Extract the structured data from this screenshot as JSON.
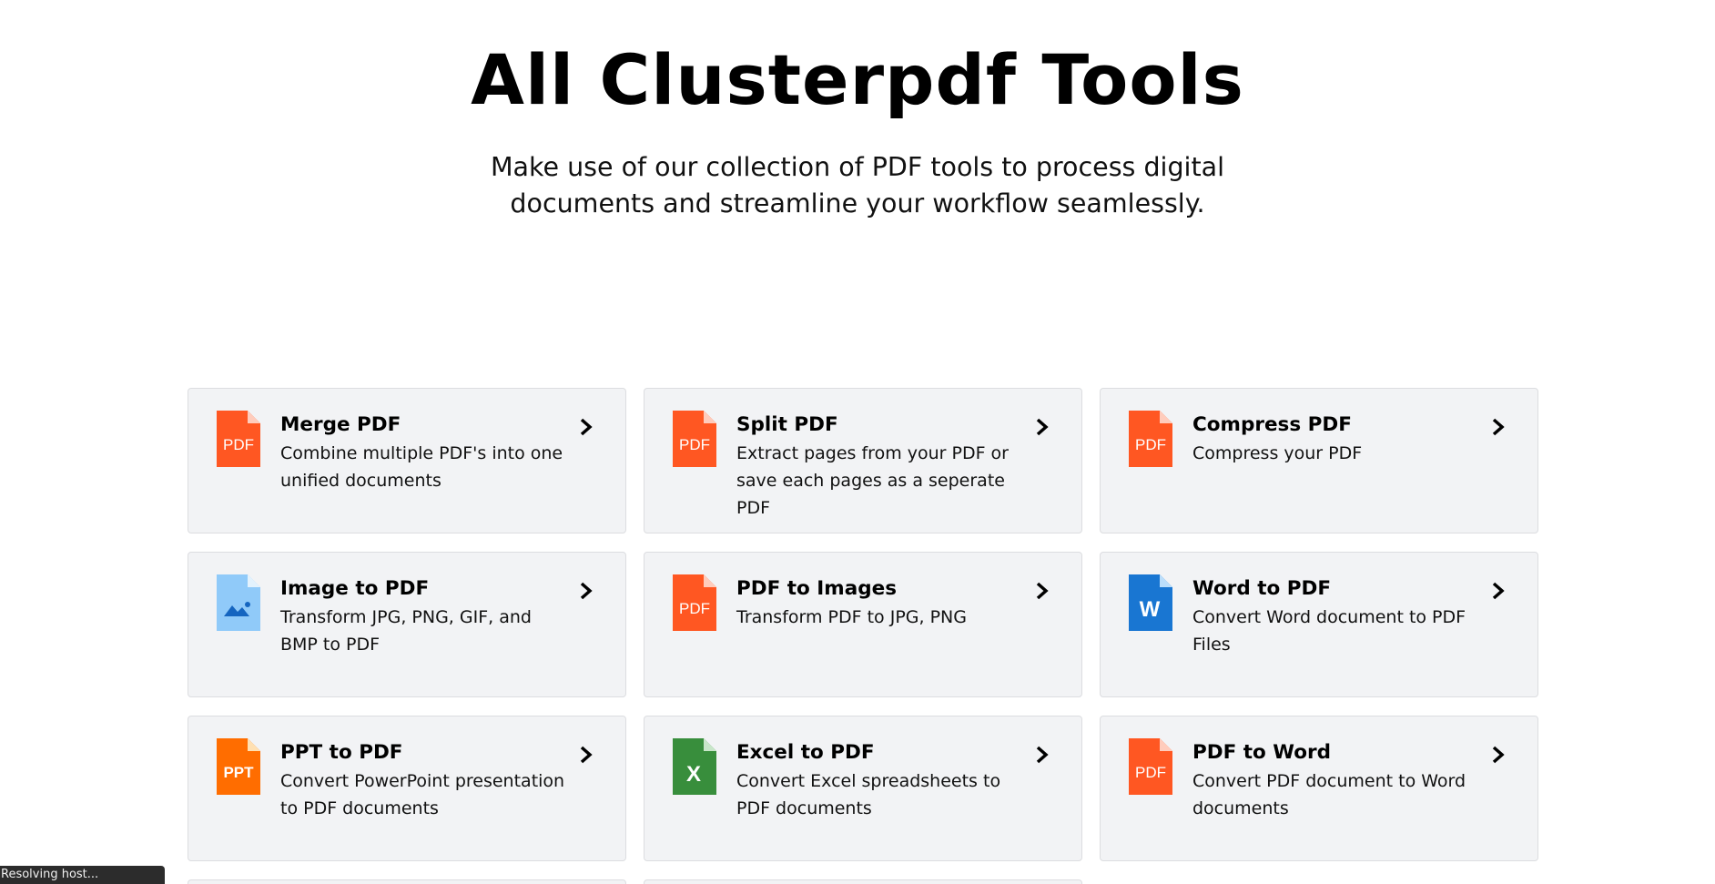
{
  "header": {
    "title": "All Clusterpdf Tools",
    "subtitle": "Make use of our collection of PDF tools to process digital documents and streamline your workflow seamlessly."
  },
  "colors": {
    "pdf": "#ff5722",
    "ppt": "#ff6d00",
    "excel": "#388e3c",
    "word": "#1976d2",
    "image": "#90caf9",
    "card_bg": "#f2f3f5"
  },
  "tools": [
    {
      "name": "Merge PDF",
      "description": "Combine multiple PDF's into one unified documents",
      "icon": "pdf-file-icon",
      "icon_text": "PDF"
    },
    {
      "name": "Split PDF",
      "description": "Extract pages from your PDF or save each pages as a seperate PDF",
      "icon": "pdf-file-icon",
      "icon_text": "PDF"
    },
    {
      "name": "Compress PDF",
      "description": "Compress your PDF",
      "icon": "pdf-file-icon",
      "icon_text": "PDF"
    },
    {
      "name": "Image to PDF",
      "description": "Transform JPG, PNG, GIF, and BMP to PDF",
      "icon": "image-file-icon",
      "icon_text": ""
    },
    {
      "name": "PDF to Images",
      "description": "Transform PDF to JPG, PNG",
      "icon": "pdf-file-icon",
      "icon_text": "PDF"
    },
    {
      "name": "Word to PDF",
      "description": "Convert Word document to PDF Files",
      "icon": "word-file-icon",
      "icon_text": "W"
    },
    {
      "name": "PPT to PDF",
      "description": "Convert PowerPoint presentation to PDF documents",
      "icon": "ppt-file-icon",
      "icon_text": "PPT"
    },
    {
      "name": "Excel to PDF",
      "description": "Convert Excel spreadsheets to PDF documents",
      "icon": "excel-file-icon",
      "icon_text": "X"
    },
    {
      "name": "PDF to Word",
      "description": "Convert PDF document to Word documents",
      "icon": "pdf-file-icon",
      "icon_text": "PDF"
    }
  ],
  "status_bar": {
    "text": "Resolving host..."
  }
}
